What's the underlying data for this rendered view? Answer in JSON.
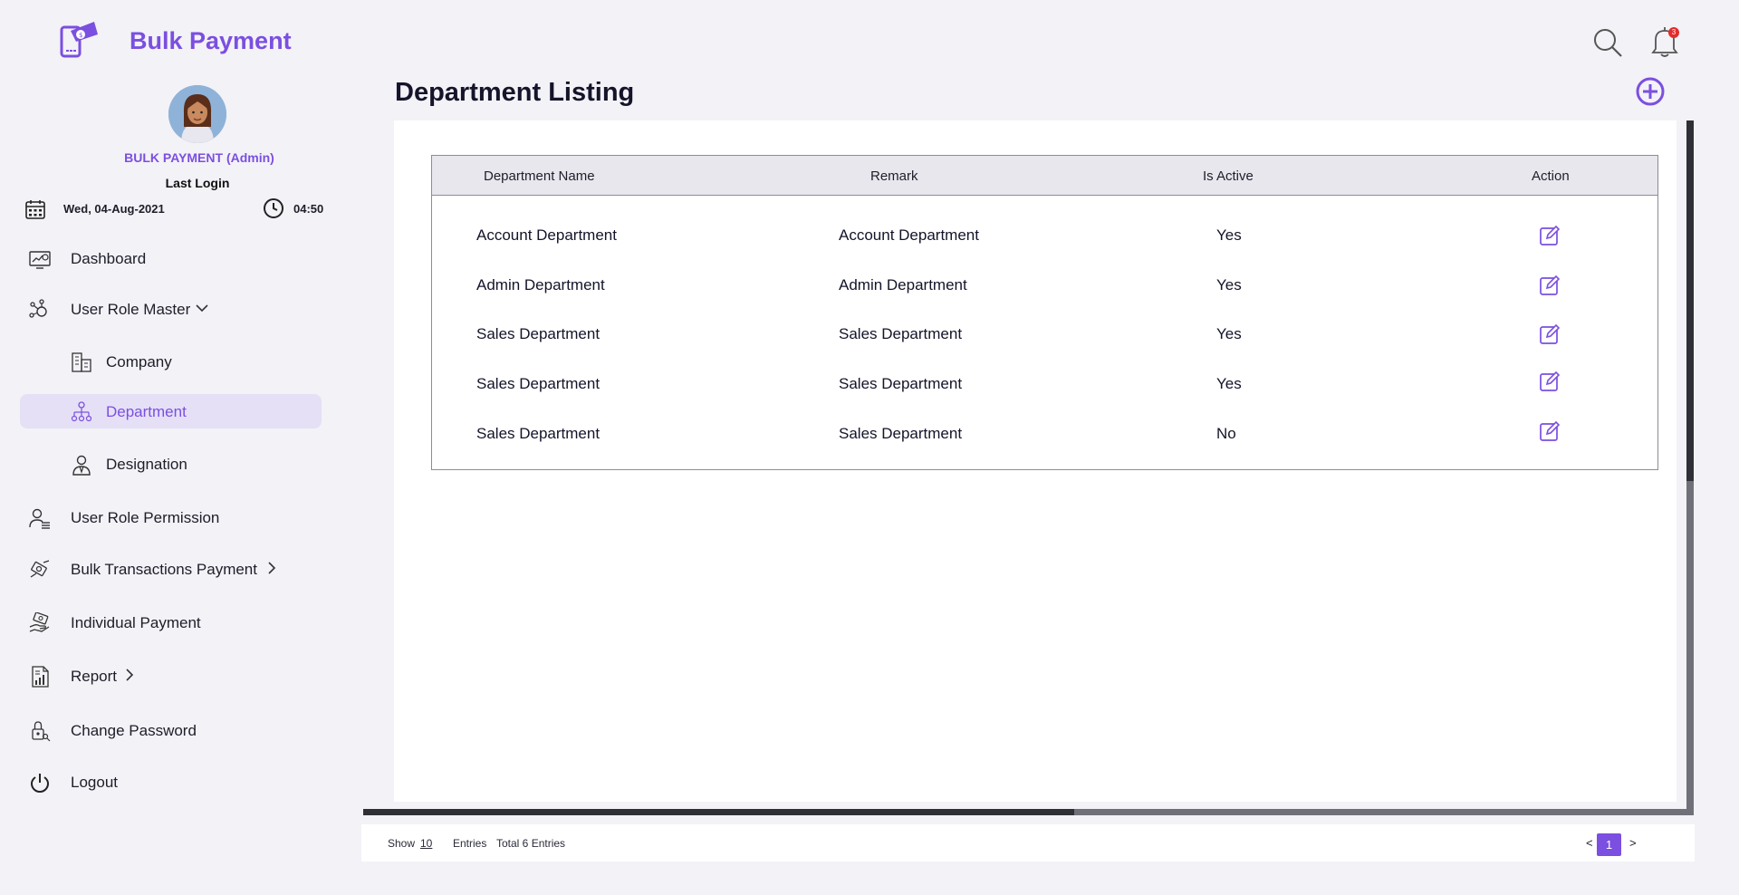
{
  "brand": {
    "title": "Bulk Payment"
  },
  "user": {
    "name": "BULK PAYMENT (Admin)",
    "last_login_label": "Last Login",
    "date": "Wed, 04-Aug-2021",
    "time": "04:50"
  },
  "nav": {
    "dashboard": "Dashboard",
    "user_role_master": "User Role Master",
    "company": "Company",
    "department": "Department",
    "designation": "Designation",
    "user_role_permission": "User Role Permission",
    "bulk_transactions_payment": "Bulk Transactions Payment",
    "individual_payment": "Individual Payment",
    "report": "Report",
    "change_password": "Change Password",
    "logout": "Logout"
  },
  "header": {
    "notification_count": "3"
  },
  "page": {
    "title": "Department Listing"
  },
  "table": {
    "columns": [
      "Department Name",
      "Remark",
      "Is Active",
      "Action"
    ],
    "rows": [
      {
        "name": "Account Department",
        "remark": "Account Department",
        "active": "Yes"
      },
      {
        "name": "Admin Department",
        "remark": "Admin Department",
        "active": "Yes"
      },
      {
        "name": "Sales Department",
        "remark": "Sales Department",
        "active": "Yes"
      },
      {
        "name": "Sales Department",
        "remark": "Sales Department",
        "active": "Yes"
      },
      {
        "name": "Sales Department",
        "remark": "Sales Department",
        "active": "No"
      }
    ]
  },
  "footer": {
    "show_label": "Show",
    "page_size": "10",
    "entries_label": "Entries",
    "total": "Total 6 Entries",
    "prev": "<",
    "current_page": "1",
    "next": ">"
  },
  "colors": {
    "accent": "#7b4fe0",
    "active_bg": "#e5e0f6",
    "badge": "#e32b2b"
  }
}
